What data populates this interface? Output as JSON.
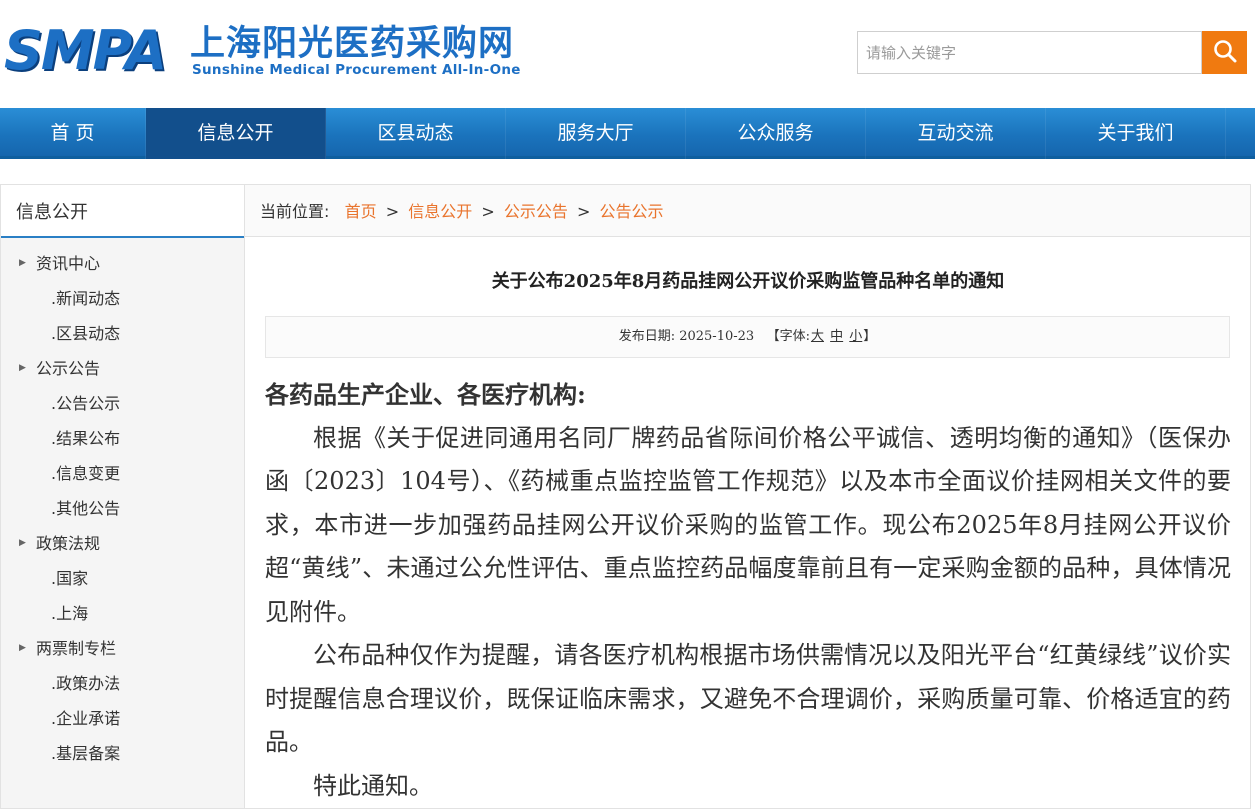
{
  "header": {
    "logo_abbr": "SMPA",
    "logo_cn": "上海阳光医药采购网",
    "logo_en": "Sunshine Medical Procurement All-In-One",
    "search_placeholder": "请输入关键字",
    "search_icon": "search-icon"
  },
  "nav": {
    "items": [
      "首 页",
      "信息公开",
      "区县动态",
      "服务大厅",
      "公众服务",
      "互动交流",
      "关于我们"
    ],
    "active": "信息公开"
  },
  "sidebar": {
    "title": "信息公开",
    "groups": [
      {
        "label": "资讯中心",
        "items": [
          ".新闻动态",
          ".区县动态"
        ]
      },
      {
        "label": "公示公告",
        "items": [
          ".公告公示",
          ".结果公布",
          ".信息变更",
          ".其他公告"
        ]
      },
      {
        "label": "政策法规",
        "items": [
          ".国家",
          ".上海"
        ]
      },
      {
        "label": "两票制专栏",
        "items": [
          ".政策办法",
          ".企业承诺",
          ".基层备案"
        ]
      }
    ]
  },
  "breadcrumb": {
    "prefix": "当前位置:",
    "items": [
      "首页",
      "信息公开",
      "公示公告",
      "公告公示"
    ],
    "separator": ">"
  },
  "article": {
    "title": "关于公布2025年8月药品挂网公开议价采购监管品种名单的通知",
    "date_label": "发布日期:",
    "date": "2025-10-23",
    "font_label_open": "【字体:",
    "font_sizes": [
      "大",
      "中",
      "小"
    ],
    "font_label_close": "】",
    "greeting": "各药品生产企业、各医疗机构:",
    "paragraphs": [
      "根据《关于促进同通用名同厂牌药品省际间价格公平诚信、透明均衡的通知》（医保办函〔2023〕104号）、《药械重点监控监管工作规范》以及本市全面议价挂网相关文件的要求，本市进一步加强药品挂网公开议价采购的监管工作。现公布2025年8月挂网公开议价超“黄线”、未通过公允性评估、重点监控药品幅度靠前且有一定采购金额的品种，具体情况见附件。",
      "公布品种仅作为提醒，请各医疗机构根据市场供需情况以及阳光平台“红黄绿线”议价实时提醒信息合理议价，既保证临床需求，又避免不合理调价，采购质量可靠、价格适宜的药品。",
      "特此通知。"
    ]
  },
  "colors": {
    "brand_blue": "#1d6fc4",
    "nav_blue": "#1b74bd",
    "nav_active": "#124f8c",
    "accent_orange": "#f07a10",
    "link_orange": "#e9742d"
  }
}
